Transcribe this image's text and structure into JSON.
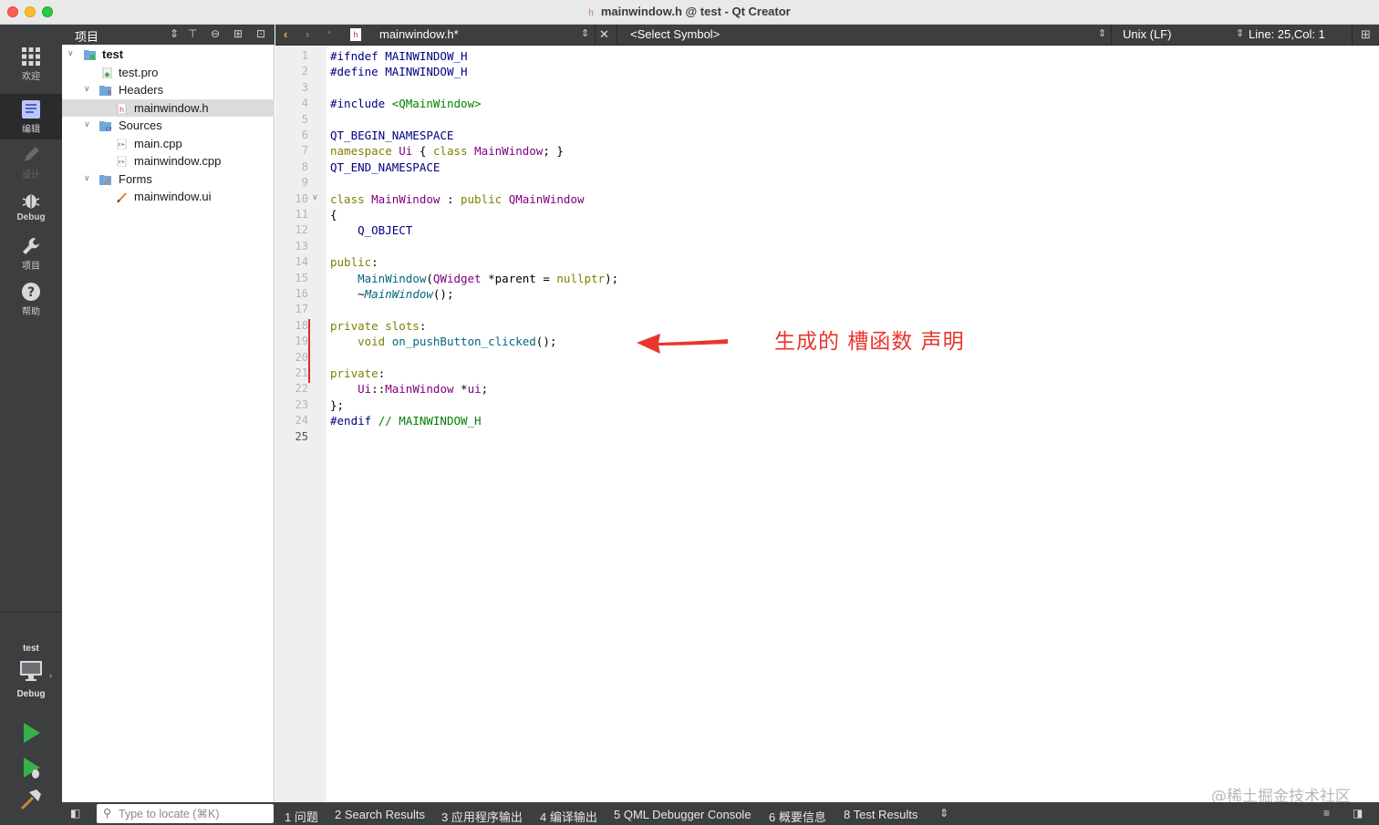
{
  "window": {
    "title": "mainwindow.h @ test - Qt Creator",
    "file_icon_glyph": "h"
  },
  "modes": [
    {
      "label": "欢迎",
      "icon": "welcome-grid-icon"
    },
    {
      "label": "编辑",
      "icon": "edit-document-icon",
      "active": true
    },
    {
      "label": "设计",
      "icon": "design-pencil-icon",
      "disabled": true
    },
    {
      "label": "Debug",
      "icon": "debug-bug-icon"
    },
    {
      "label": "项目",
      "icon": "projects-wrench-icon"
    },
    {
      "label": "帮助",
      "icon": "help-question-icon"
    }
  ],
  "kit": {
    "project": "test",
    "config": "Debug"
  },
  "project_panel": {
    "title": "项目",
    "tree": [
      {
        "label": "test",
        "depth": 0,
        "expanded": true,
        "bold": true,
        "icon": "project-folder-icon"
      },
      {
        "label": "test.pro",
        "depth": 1,
        "icon": "pro-file-icon"
      },
      {
        "label": "Headers",
        "depth": 1,
        "expanded": true,
        "icon": "headers-folder-icon"
      },
      {
        "label": "mainwindow.h",
        "depth": 2,
        "icon": "header-file-icon",
        "selected": true
      },
      {
        "label": "Sources",
        "depth": 1,
        "expanded": true,
        "icon": "sources-folder-icon"
      },
      {
        "label": "main.cpp",
        "depth": 2,
        "icon": "cpp-file-icon"
      },
      {
        "label": "mainwindow.cpp",
        "depth": 2,
        "icon": "cpp-file-icon"
      },
      {
        "label": "Forms",
        "depth": 1,
        "expanded": true,
        "icon": "forms-folder-icon"
      },
      {
        "label": "mainwindow.ui",
        "depth": 2,
        "icon": "ui-file-icon"
      }
    ]
  },
  "editor_toolbar": {
    "document": "mainwindow.h*",
    "symbol": "<Select Symbol>",
    "line_ending": "Unix (LF)",
    "position": "Line: 25,Col: 1"
  },
  "editor": {
    "current_line": 25,
    "lines": [
      "1",
      "2",
      "3",
      "4",
      "5",
      "6",
      "7",
      "8",
      "9",
      "10",
      "11",
      "12",
      "13",
      "14",
      "15",
      "16",
      "17",
      "18",
      "19",
      "20",
      "21",
      "22",
      "23",
      "24",
      "25"
    ],
    "code": {
      "l1a": "#ifndef ",
      "l1b": "MAINWINDOW_H",
      "l2a": "#define ",
      "l2b": "MAINWINDOW_H",
      "l4a": "#include ",
      "l4b": "<QMainWindow>",
      "l6": "QT_BEGIN_NAMESPACE",
      "l7a": "namespace ",
      "l7b": "Ui",
      "l7c": " { ",
      "l7d": "class ",
      "l7e": "MainWindow",
      "l7f": "; }",
      "l8": "QT_END_NAMESPACE",
      "l10a": "class ",
      "l10b": "MainWindow",
      "l10c": " : ",
      "l10d": "public ",
      "l10e": "QMainWindow",
      "l11": "{",
      "l12": "    Q_OBJECT",
      "l14a": "public",
      "l14b": ":",
      "l15a": "    ",
      "l15b": "MainWindow",
      "l15c": "(",
      "l15d": "QWidget",
      "l15e": " *",
      "l15f": "parent",
      "l15g": " = ",
      "l15h": "nullptr",
      "l15i": ");",
      "l16a": "    ~",
      "l16b": "MainWindow",
      "l16c": "();",
      "l18a": "private slots",
      "l18b": ":",
      "l19a": "    ",
      "l19b": "void ",
      "l19c": "on_pushButton_clicked",
      "l19d": "();",
      "l21a": "private",
      "l21b": ":",
      "l22a": "    ",
      "l22b": "Ui",
      "l22c": "::",
      "l22d": "MainWindow",
      "l22e": " *",
      "l22f": "ui",
      "l22g": ";",
      "l23": "};",
      "l24a": "#endif ",
      "l24b": "// MAINWINDOW_H"
    }
  },
  "annotation": {
    "text": "生成的 槽函数 声明",
    "color": "#e8362f"
  },
  "watermark": "@稀土掘金技术社区",
  "statusbar": {
    "locate_placeholder": "Type to locate (⌘K)",
    "panes": [
      "1  问题",
      "2  Search Results",
      "3  应用程序输出",
      "4  编译输出",
      "5  QML Debugger Console",
      "6  概要信息",
      "8  Test Results"
    ]
  },
  "colors": {
    "sidebar": "#3d3e40",
    "keyword": "#808000",
    "type": "#800080",
    "macro": "#000080",
    "string": "#008000",
    "change_marker": "#d42c2c"
  }
}
